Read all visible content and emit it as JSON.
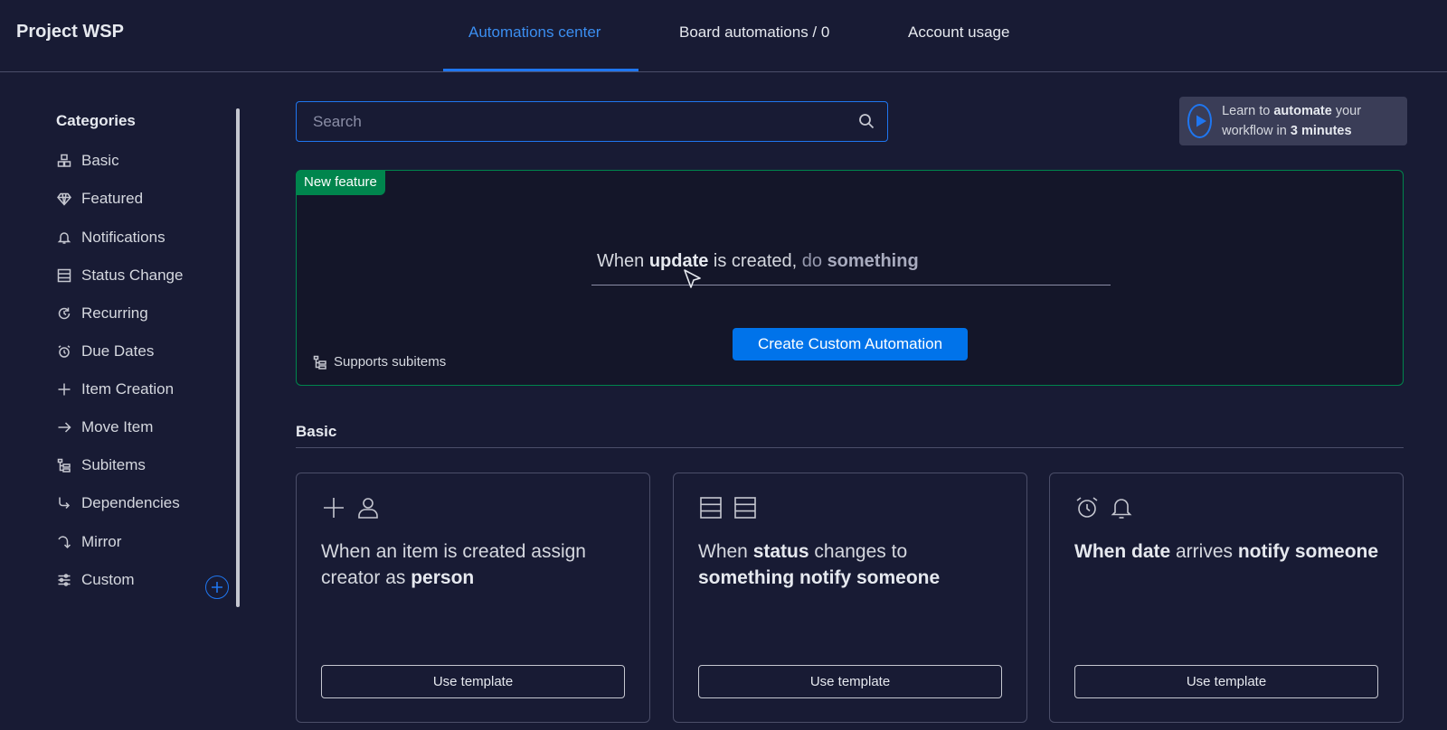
{
  "header": {
    "project_title": "Project WSP",
    "tabs": [
      {
        "label": "Automations center",
        "active": true
      },
      {
        "label": "Board automations / 0",
        "active": false
      },
      {
        "label": "Account usage",
        "active": false
      }
    ]
  },
  "sidebar": {
    "heading": "Categories",
    "items": [
      {
        "label": "Basic",
        "icon": "basic-icon"
      },
      {
        "label": "Featured",
        "icon": "diamond-icon"
      },
      {
        "label": "Notifications",
        "icon": "bell-icon"
      },
      {
        "label": "Status Change",
        "icon": "status-icon"
      },
      {
        "label": "Recurring",
        "icon": "recurring-icon"
      },
      {
        "label": "Due Dates",
        "icon": "alarm-icon"
      },
      {
        "label": "Item Creation",
        "icon": "plus-icon"
      },
      {
        "label": "Move Item",
        "icon": "arrow-right-icon"
      },
      {
        "label": "Subitems",
        "icon": "subitems-icon"
      },
      {
        "label": "Dependencies",
        "icon": "dependency-icon"
      },
      {
        "label": "Mirror",
        "icon": "mirror-icon"
      },
      {
        "label": "Custom",
        "icon": "sliders-icon"
      }
    ]
  },
  "search": {
    "placeholder": "Search",
    "value": ""
  },
  "learn": {
    "prefix": "Learn to ",
    "bold1": "automate",
    "middle": " your workflow in ",
    "bold2": "3 minutes"
  },
  "feature": {
    "badge": "New feature",
    "recipe": {
      "w1": "When ",
      "w2": "update",
      "w3": " is created,",
      "w4": " do ",
      "w5": "something"
    },
    "create_button": "Create Custom Automation",
    "supports_subitems": "Supports subitems"
  },
  "section": {
    "title": "Basic"
  },
  "templates": [
    {
      "parts": [
        "When an item is created assign creator as ",
        "person"
      ],
      "button": "Use template"
    },
    {
      "parts": [
        "When ",
        "status",
        " changes to ",
        "something notify someone"
      ],
      "button": "Use template"
    },
    {
      "parts": [
        "When date",
        " arrives ",
        "notify someone"
      ],
      "button": "Use template"
    }
  ],
  "colors": {
    "background": "#181b34",
    "accent": "#0073ea",
    "feature_green": "#00854d"
  }
}
